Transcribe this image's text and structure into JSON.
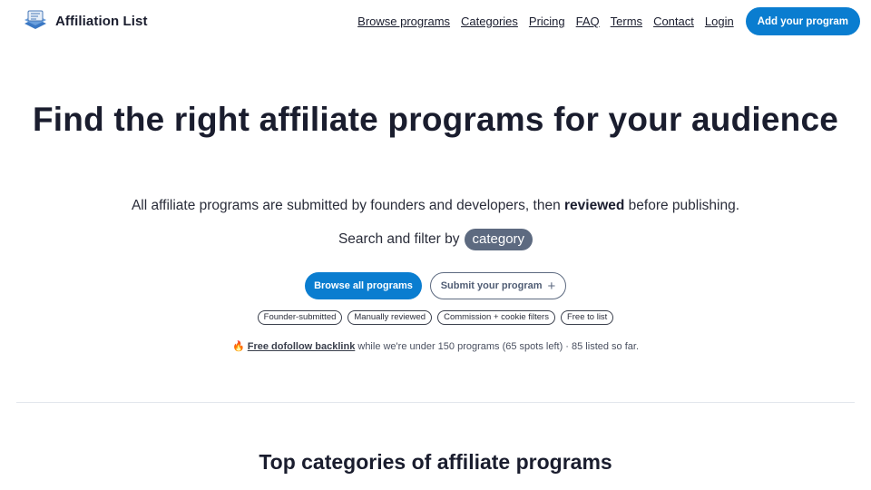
{
  "brand": {
    "name": "Affiliation List",
    "logo_icon": "stacked-cards-logo-icon"
  },
  "nav": {
    "links": [
      "Browse programs",
      "Categories",
      "Pricing",
      "FAQ",
      "Terms",
      "Contact",
      "Login"
    ],
    "cta_label": "Add your program"
  },
  "hero": {
    "title": "Find the right affiliate programs for your audience",
    "subtitle_pre": "All affiliate programs are submitted by founders and developers, then ",
    "subtitle_bold": "reviewed",
    "subtitle_post": " before publishing.",
    "search_text": "Search and filter by",
    "search_chip": "category",
    "primary_button": "Browse all programs",
    "secondary_button": "Submit your program",
    "tags": [
      "Founder-submitted",
      "Manually reviewed",
      "Commission + cookie filters",
      "Free to list"
    ],
    "note_link": "Free dofollow backlink",
    "note_text": " while we're under 150 programs (65 spots left) · 85 listed so far."
  },
  "sections": {
    "top_categories_title": "Top categories of affiliate programs"
  },
  "colors": {
    "accent": "#0a7dd0",
    "chip": "#5d6a80",
    "text": "#1a1d2e"
  }
}
